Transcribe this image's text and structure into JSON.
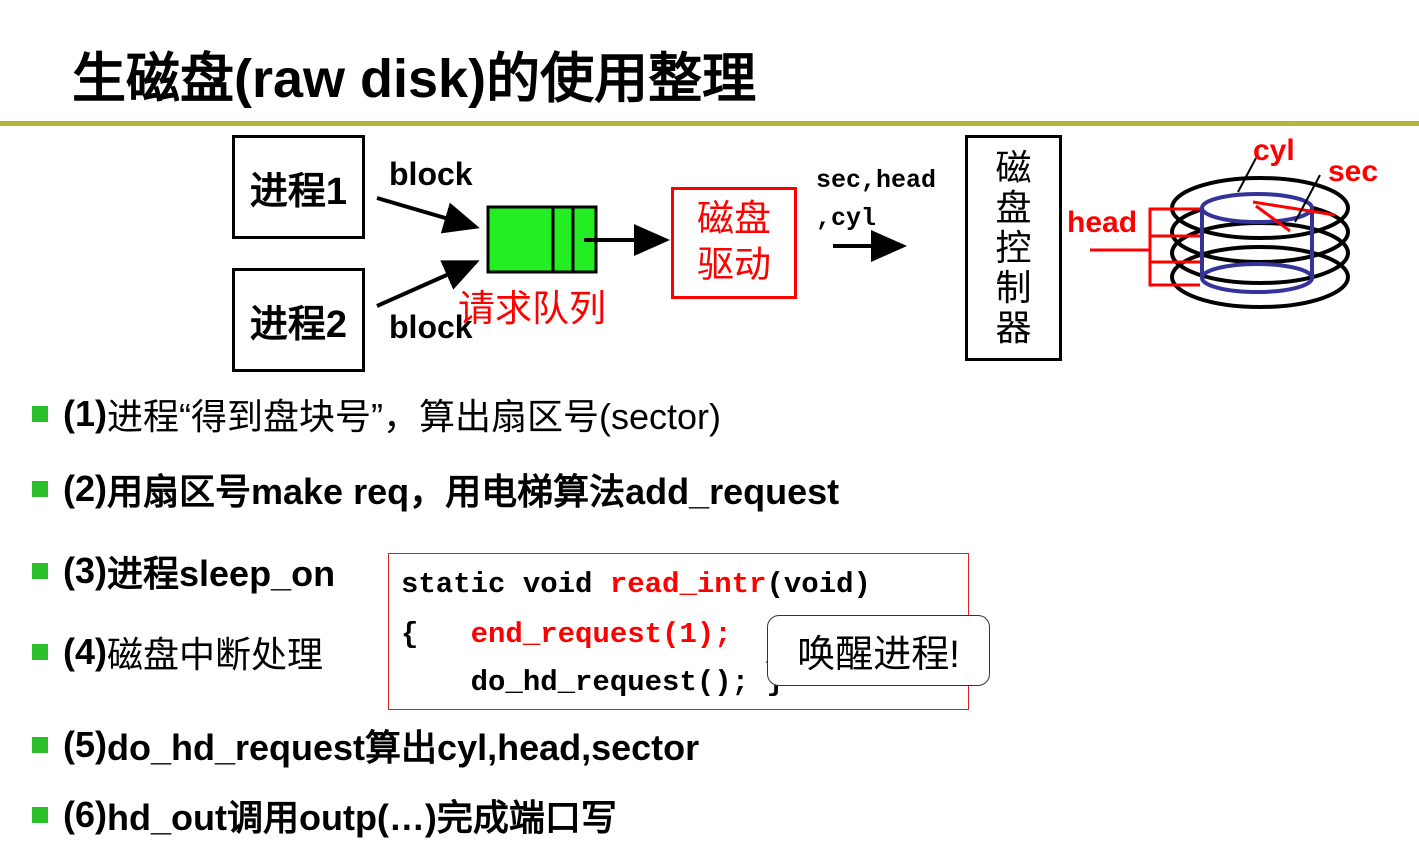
{
  "title": "生磁盘(raw disk)的使用整理",
  "diagram": {
    "process1": "进程1",
    "process2": "进程2",
    "block_top": "block",
    "block_bottom": "block",
    "queue_label": "请求队列",
    "driver_line1": "磁盘",
    "driver_line2": "驱动",
    "params_line1": "sec,head",
    "params_line2": ",cyl",
    "controller": [
      "磁",
      "盘",
      "控",
      "制",
      "器"
    ],
    "disk_labels": {
      "cyl": "cyl",
      "sec": "sec",
      "head": "head"
    },
    "colors": {
      "queue": "#22ee22",
      "accent": "#ff0000",
      "cylinder": "#333399",
      "rule": "#b4b63a",
      "bullet": "#2bbf2b"
    }
  },
  "bullets": [
    {
      "num": "(1)",
      "text": " 进程“得到盘块号”，算出扇区号(sector)"
    },
    {
      "num": "(2)",
      "text": " 用扇区号make req，用电梯算法add_request"
    },
    {
      "num": "(3)",
      "text": " 进程sleep_on"
    },
    {
      "num": "(4)",
      "text": " 磁盘中断处理"
    },
    {
      "num": "(5)",
      "text": " do_hd_request算出cyl,head,sector"
    },
    {
      "num": "(6)",
      "text": " hd_out调用outp(…)完成端口写"
    }
  ],
  "code": {
    "l1a": "static void ",
    "l1b": "read_intr",
    "l1c": "(void)",
    "l2a": "{   ",
    "l2b": "end_request(1);",
    "l3a": "    do_hd_request(); }"
  },
  "callout": "唤醒进程!"
}
